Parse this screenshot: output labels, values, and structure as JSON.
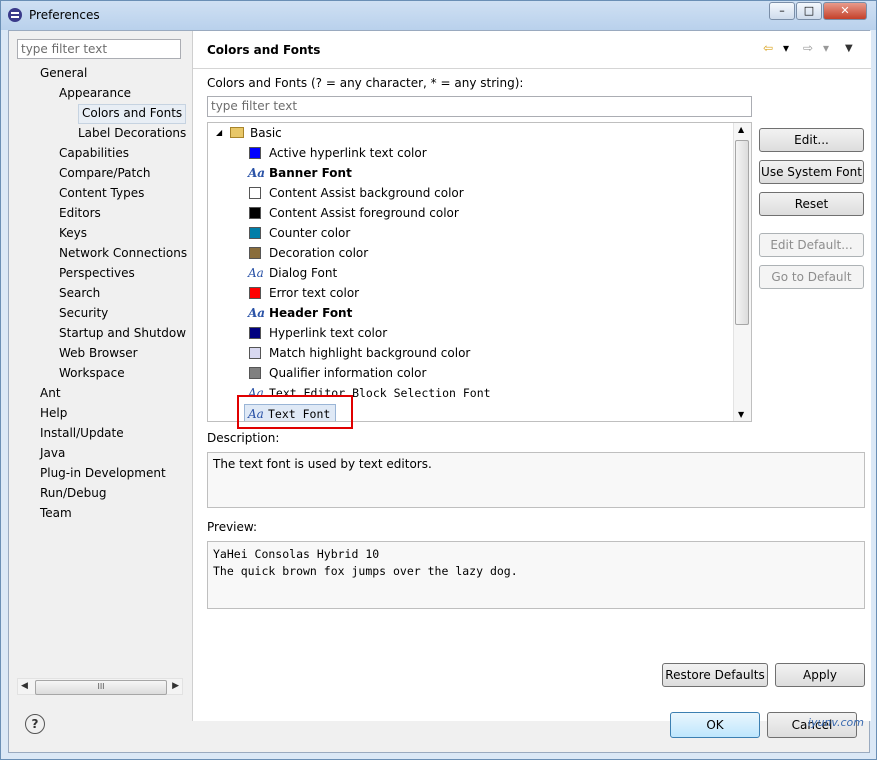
{
  "window": {
    "title": "Preferences",
    "controls": [
      "–",
      "□",
      "✕"
    ]
  },
  "left": {
    "filter_placeholder": "type filter text",
    "items": [
      {
        "label": "General",
        "level": 0
      },
      {
        "label": "Appearance",
        "level": 1
      },
      {
        "label": "Colors and Fonts",
        "level": 2,
        "selected": true
      },
      {
        "label": "Label Decorations",
        "level": 2
      },
      {
        "label": "Capabilities",
        "level": 1
      },
      {
        "label": "Compare/Patch",
        "level": 1
      },
      {
        "label": "Content Types",
        "level": 1
      },
      {
        "label": "Editors",
        "level": 1
      },
      {
        "label": "Keys",
        "level": 1
      },
      {
        "label": "Network Connections",
        "level": 1
      },
      {
        "label": "Perspectives",
        "level": 1
      },
      {
        "label": "Search",
        "level": 1
      },
      {
        "label": "Security",
        "level": 1
      },
      {
        "label": "Startup and Shutdow",
        "level": 1
      },
      {
        "label": "Web Browser",
        "level": 1
      },
      {
        "label": "Workspace",
        "level": 1
      },
      {
        "label": "Ant",
        "level": 0
      },
      {
        "label": "Help",
        "level": 0
      },
      {
        "label": "Install/Update",
        "level": 0
      },
      {
        "label": "Java",
        "level": 0
      },
      {
        "label": "Plug-in Development",
        "level": 0
      },
      {
        "label": "Run/Debug",
        "level": 0
      },
      {
        "label": "Team",
        "level": 0
      }
    ],
    "scrollbar_grip": "III"
  },
  "right": {
    "title": "Colors and Fonts",
    "nav": {
      "back": "⇦",
      "forward": "⇨",
      "dropdown": "▾",
      "menu": "▼"
    },
    "filter_label": "Colors and Fonts (? = any character, * = any string):",
    "filter_placeholder": "type filter text",
    "tree": {
      "group_expander": "◢",
      "group_label": "Basic",
      "items": [
        {
          "label": "Active hyperlink text color",
          "kind": "color",
          "color": "#0000ff"
        },
        {
          "label": "Banner Font",
          "kind": "font",
          "bold": true
        },
        {
          "label": "Content Assist background color",
          "kind": "color",
          "color": "#ffffff"
        },
        {
          "label": "Content Assist foreground color",
          "kind": "color",
          "color": "#000000"
        },
        {
          "label": "Counter color",
          "kind": "color",
          "color": "#007ea8"
        },
        {
          "label": "Decoration color",
          "kind": "color",
          "color": "#8a6d3b"
        },
        {
          "label": "Dialog Font",
          "kind": "font"
        },
        {
          "label": "Error text color",
          "kind": "color",
          "color": "#ff0000"
        },
        {
          "label": "Header Font",
          "kind": "font",
          "bold": true
        },
        {
          "label": "Hyperlink text color",
          "kind": "color",
          "color": "#000080"
        },
        {
          "label": "Match highlight background color",
          "kind": "color",
          "color": "#d8d8f0"
        },
        {
          "label": "Qualifier information color",
          "kind": "color",
          "color": "#808080"
        },
        {
          "label": "Text Editor Block Selection Font",
          "kind": "font",
          "mono": true
        },
        {
          "label": "Text Font",
          "kind": "font",
          "mono": true,
          "selected": true
        }
      ],
      "font_icon": "Aa"
    },
    "buttons": {
      "edit": "Edit...",
      "use_system_font": "Use System Font",
      "reset": "Reset",
      "edit_default": "Edit Default...",
      "go_to_default": "Go to Default"
    },
    "description_label": "Description:",
    "description_text": "The text font is used by text editors.",
    "preview_label": "Preview:",
    "preview_line1": "YaHei Consolas Hybrid 10",
    "preview_line2": "The quick brown fox jumps over the lazy dog.",
    "restore_defaults": "Restore Defaults",
    "apply": "Apply"
  },
  "footer": {
    "help": "?",
    "ok": "OK",
    "cancel": "Cancel",
    "watermark": "iyunv.com"
  }
}
